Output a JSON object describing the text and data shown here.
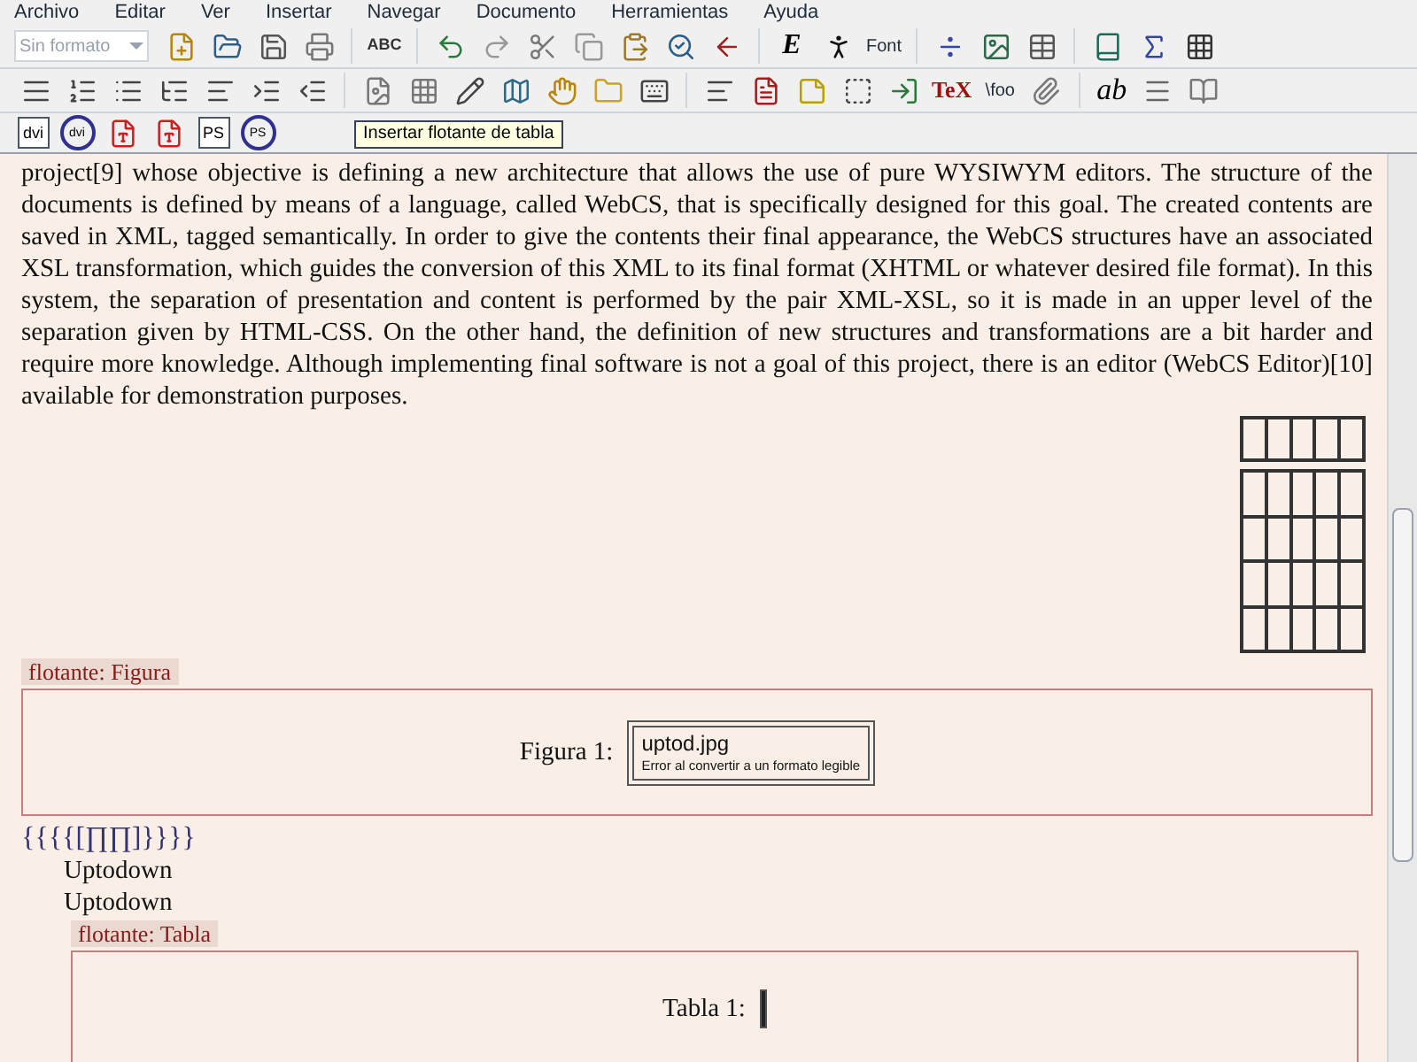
{
  "menu": [
    "Archivo",
    "Editar",
    "Ver",
    "Insertar",
    "Navegar",
    "Documento",
    "Herramientas",
    "Ayuda"
  ],
  "style_select": {
    "value": "Sin formato"
  },
  "toolbar_rows": [
    [
      {
        "kind": "icon"
      },
      {
        "kind": "icon"
      },
      {
        "kind": "icon"
      },
      {
        "kind": "icon"
      },
      {
        "kind": "sep"
      },
      {
        "kind": "text",
        "label": "ABC"
      },
      {
        "kind": "sep"
      },
      {
        "kind": "icon"
      },
      {
        "kind": "icon"
      },
      {
        "kind": "icon"
      },
      {
        "kind": "icon"
      },
      {
        "kind": "icon"
      },
      {
        "kind": "icon"
      },
      {
        "kind": "icon"
      },
      {
        "kind": "sep"
      },
      {
        "kind": "text",
        "label": "E"
      },
      {
        "kind": "icon"
      },
      {
        "kind": "text",
        "label": "Font"
      },
      {
        "kind": "sep"
      },
      {
        "kind": "icon"
      },
      {
        "kind": "icon"
      },
      {
        "kind": "icon"
      },
      {
        "kind": "sep"
      },
      {
        "kind": "icon"
      },
      {
        "kind": "icon"
      },
      {
        "kind": "icon"
      }
    ],
    [
      {
        "kind": "icon"
      },
      {
        "kind": "icon"
      },
      {
        "kind": "icon"
      },
      {
        "kind": "icon"
      },
      {
        "kind": "icon"
      },
      {
        "kind": "icon"
      },
      {
        "kind": "icon"
      },
      {
        "kind": "sep"
      },
      {
        "kind": "icon"
      },
      {
        "kind": "icon"
      },
      {
        "kind": "icon"
      },
      {
        "kind": "icon"
      },
      {
        "kind": "icon"
      },
      {
        "kind": "icon"
      },
      {
        "kind": "icon"
      },
      {
        "kind": "sep"
      },
      {
        "kind": "icon"
      },
      {
        "kind": "icon"
      },
      {
        "kind": "icon"
      },
      {
        "kind": "icon"
      },
      {
        "kind": "icon"
      },
      {
        "kind": "text",
        "label": "TeX"
      },
      {
        "kind": "text",
        "label": "\\foo"
      },
      {
        "kind": "icon"
      },
      {
        "kind": "sep"
      },
      {
        "kind": "text",
        "label": "ab"
      },
      {
        "kind": "icon"
      },
      {
        "kind": "icon"
      }
    ],
    [
      {
        "kind": "boxed",
        "label": "dvi"
      },
      {
        "kind": "cycle",
        "label": "dvi"
      },
      {
        "kind": "icon"
      },
      {
        "kind": "icon"
      },
      {
        "kind": "boxed",
        "label": "PS"
      },
      {
        "kind": "cycle",
        "label": "PS"
      }
    ]
  ],
  "tooltip": "Insertar flotante de tabla",
  "paragraph": "project[9] whose objective is defining a new architecture that allows the use of pure WYSIWYM editors. The structure of the documents is defined by means of a language, called WebCS, that is specifically designed for this goal. The created contents are saved in XML, tagged semantically. In order to give the contents their final appearance, the WebCS structures have an associated XSL transformation, which guides the conversion of this XML to its final format (XHTML or whatever desired file format). In this system, the separation of presentation and content is performed by the pair XML-XSL, so it is made in an upper level of the separation given by HTML-CSS. On the other hand, the definition of new structures and transformations are a bit harder and require more knowledge. Although implementing final software is not a goal of this project, there is an editor (WebCS Editor)[10] available for demonstration purposes.",
  "figure_float": {
    "label": "flotante: Figura",
    "caption": "Figura 1:",
    "image_name": "uptod.jpg",
    "image_error": "Error al convertir a un formato legible"
  },
  "formula": "{{{{[∏∏]}}}}",
  "lines": [
    "Uptodown",
    "Uptodown"
  ],
  "table_float": {
    "label": "flotante: Tabla",
    "caption": "Tabla 1:"
  }
}
